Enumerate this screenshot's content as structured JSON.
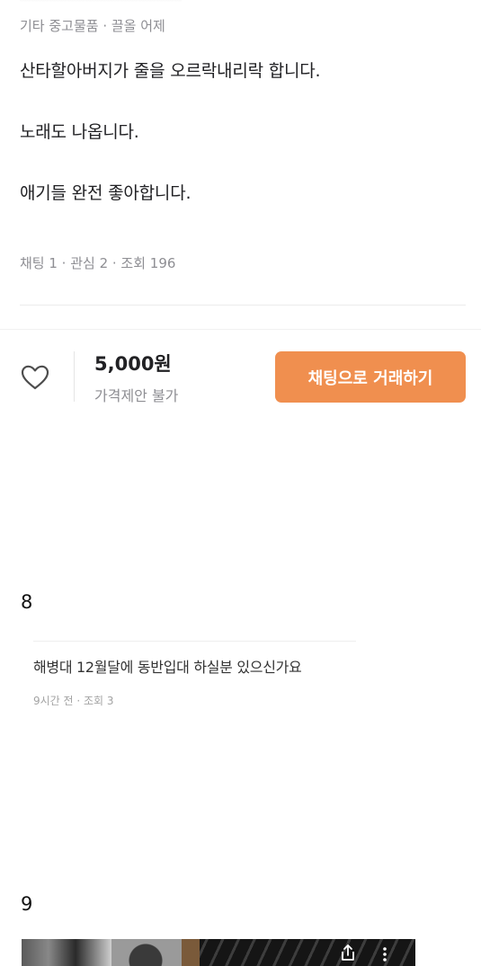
{
  "listing": {
    "meta": "기타 중고물품 · 끌올 어제",
    "description": [
      "산타할아버지가 줄을 오르락내리락 합니다.",
      "노래도 나옵니다.",
      "애기들 완전 좋아합니다."
    ],
    "stats": "채팅 1 · 관심 2 · 조회 196"
  },
  "bottom_bar": {
    "price": "5,000원",
    "price_note": "가격제안 불가",
    "chat_button": "채팅으로 거래하기",
    "heart_icon": "heart-outline-icon",
    "accent_color": "#f08f4f"
  },
  "sections": [
    {
      "number": "8"
    },
    {
      "number": "9"
    }
  ],
  "post": {
    "title": "해병대 12월달에 동반입대 하실분 있으신가요",
    "meta": "9시간 전 · 조회 3"
  },
  "thumbnail": {
    "icons": [
      "share-icon",
      "more-vertical-icon"
    ]
  }
}
